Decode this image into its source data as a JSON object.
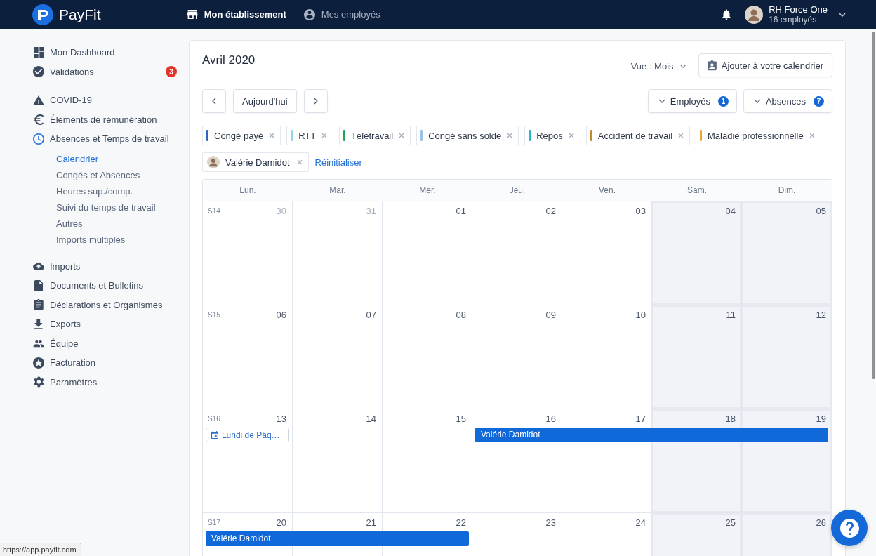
{
  "topbar": {
    "app_name": "PayFit",
    "nav": [
      {
        "label": "Mon établissement",
        "selected": true
      },
      {
        "label": "Mes employés",
        "selected": false
      }
    ],
    "account": {
      "name": "RH Force One",
      "subtitle": "16 employés"
    }
  },
  "sidebar": {
    "sections": [
      {
        "items": [
          {
            "label": "Mon Dashboard",
            "selected": false
          },
          {
            "label": "Validations",
            "selected": false,
            "badge": "3"
          }
        ]
      },
      {
        "items": [
          {
            "label": "COVID-19",
            "selected": false
          },
          {
            "label": "Éléments de rémunération",
            "selected": false
          },
          {
            "label": "Absences et Temps de travail",
            "selected": true,
            "children": [
              {
                "label": "Calendrier",
                "selected": true
              },
              {
                "label": "Congés et Absences",
                "selected": false
              },
              {
                "label": "Heures sup./comp.",
                "selected": false
              },
              {
                "label": "Suivi du temps de travail",
                "selected": false
              },
              {
                "label": "Autres",
                "selected": false
              },
              {
                "label": "Imports multiples",
                "selected": false
              }
            ]
          }
        ]
      },
      {
        "items": [
          {
            "label": "Imports",
            "selected": false
          },
          {
            "label": "Documents et Bulletins",
            "selected": false
          },
          {
            "label": "Déclarations et Organismes",
            "selected": false
          },
          {
            "label": "Exports",
            "selected": false
          },
          {
            "label": "Équipe",
            "selected": false
          },
          {
            "label": "Facturation",
            "selected": false
          },
          {
            "label": "Paramètres",
            "selected": false
          }
        ]
      }
    ]
  },
  "calendar": {
    "title": "Avril 2020",
    "view_selector": "Vue : Mois",
    "add_button": "Ajouter à votre calendrier",
    "today_button": "Aujourd'hui",
    "filters": [
      {
        "label": "Employés",
        "count": "1"
      },
      {
        "label": "Absences",
        "count": "7"
      }
    ],
    "chips": [
      {
        "label": "Congé payé",
        "color": "#2d65c0"
      },
      {
        "label": "RTT",
        "color": "#8ed8e6"
      },
      {
        "label": "Télétravail",
        "color": "#1ea653"
      },
      {
        "label": "Congé sans solde",
        "color": "#9dc2ea"
      },
      {
        "label": "Repos",
        "color": "#26b6c8"
      },
      {
        "label": "Accident de travail",
        "color": "#c7872c"
      },
      {
        "label": "Maladie professionnelle",
        "color": "#eea232"
      }
    ],
    "people": [
      {
        "label": "Valérie Damidot"
      }
    ],
    "reset_link": "Réinitialiser",
    "weekdays": [
      "Lun.",
      "Mar.",
      "Mer.",
      "Jeu.",
      "Ven.",
      "Sam.",
      "Dim."
    ],
    "weeks": [
      {
        "label": "S14",
        "days": [
          {
            "date": "30",
            "muted": true,
            "weekend": false
          },
          {
            "date": "31",
            "muted": true,
            "weekend": false
          },
          {
            "date": "01",
            "muted": false,
            "weekend": false
          },
          {
            "date": "02",
            "muted": false,
            "weekend": false
          },
          {
            "date": "03",
            "muted": false,
            "weekend": false
          },
          {
            "date": "04",
            "muted": false,
            "weekend": true
          },
          {
            "date": "05",
            "muted": false,
            "weekend": true
          }
        ]
      },
      {
        "label": "S15",
        "days": [
          {
            "date": "06",
            "muted": false,
            "weekend": false
          },
          {
            "date": "07",
            "muted": false,
            "weekend": false
          },
          {
            "date": "08",
            "muted": false,
            "weekend": false
          },
          {
            "date": "09",
            "muted": false,
            "weekend": false
          },
          {
            "date": "10",
            "muted": false,
            "weekend": false
          },
          {
            "date": "11",
            "muted": false,
            "weekend": true
          },
          {
            "date": "12",
            "muted": false,
            "weekend": true
          }
        ]
      },
      {
        "label": "S16",
        "days": [
          {
            "date": "13",
            "muted": false,
            "weekend": false,
            "event": {
              "kind": "holiday",
              "label": "Lundi de Pâq…"
            }
          },
          {
            "date": "14",
            "muted": false,
            "weekend": false
          },
          {
            "date": "15",
            "muted": false,
            "weekend": false
          },
          {
            "date": "16",
            "muted": false,
            "weekend": false,
            "event": {
              "kind": "absence",
              "label": "Valérie Damidot"
            }
          },
          {
            "date": "17",
            "muted": false,
            "weekend": false,
            "event": {
              "kind": "continuation"
            }
          },
          {
            "date": "18",
            "muted": false,
            "weekend": true,
            "event": {
              "kind": "continuation"
            }
          },
          {
            "date": "19",
            "muted": false,
            "weekend": true,
            "event": {
              "kind": "continuation"
            }
          }
        ]
      },
      {
        "label": "S17",
        "days": [
          {
            "date": "20",
            "muted": false,
            "weekend": false,
            "event": {
              "kind": "absence",
              "label": "Valérie Damidot"
            }
          },
          {
            "date": "21",
            "muted": false,
            "weekend": false,
            "event": {
              "kind": "continuation"
            }
          },
          {
            "date": "22",
            "muted": false,
            "weekend": false,
            "event": {
              "kind": "continuation"
            }
          },
          {
            "date": "23",
            "muted": false,
            "weekend": false
          },
          {
            "date": "24",
            "muted": false,
            "weekend": false
          },
          {
            "date": "25",
            "muted": false,
            "weekend": true
          },
          {
            "date": "26",
            "muted": false,
            "weekend": true
          }
        ]
      }
    ]
  },
  "status_bar": {
    "url": "https://app.payfit.com"
  }
}
